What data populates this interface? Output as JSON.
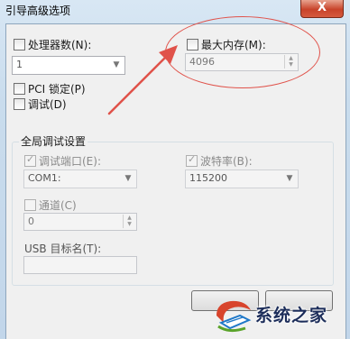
{
  "window": {
    "title": "引导高级选项",
    "close_glyph": "X"
  },
  "processors": {
    "label": "处理器数(N):",
    "value": "1"
  },
  "max_memory": {
    "label": "最大内存(M):",
    "value": "4096"
  },
  "pci_lock": {
    "label": "PCI 锁定(P)"
  },
  "debug": {
    "label": "调试(D)"
  },
  "global_debug": {
    "group_label": "全局调试设置",
    "debug_port": {
      "label": "调试端口(E):",
      "value": "COM1:"
    },
    "baud_rate": {
      "label": "波特率(B):",
      "value": "115200"
    },
    "channel": {
      "label": "通道(C)",
      "value": "0"
    },
    "usb_target": {
      "label": "USB 目标名(T):",
      "value": ""
    }
  },
  "watermark": {
    "text": "系统之家"
  },
  "colors": {
    "annotation": "#e0524a",
    "title_close": "#c8432a"
  }
}
